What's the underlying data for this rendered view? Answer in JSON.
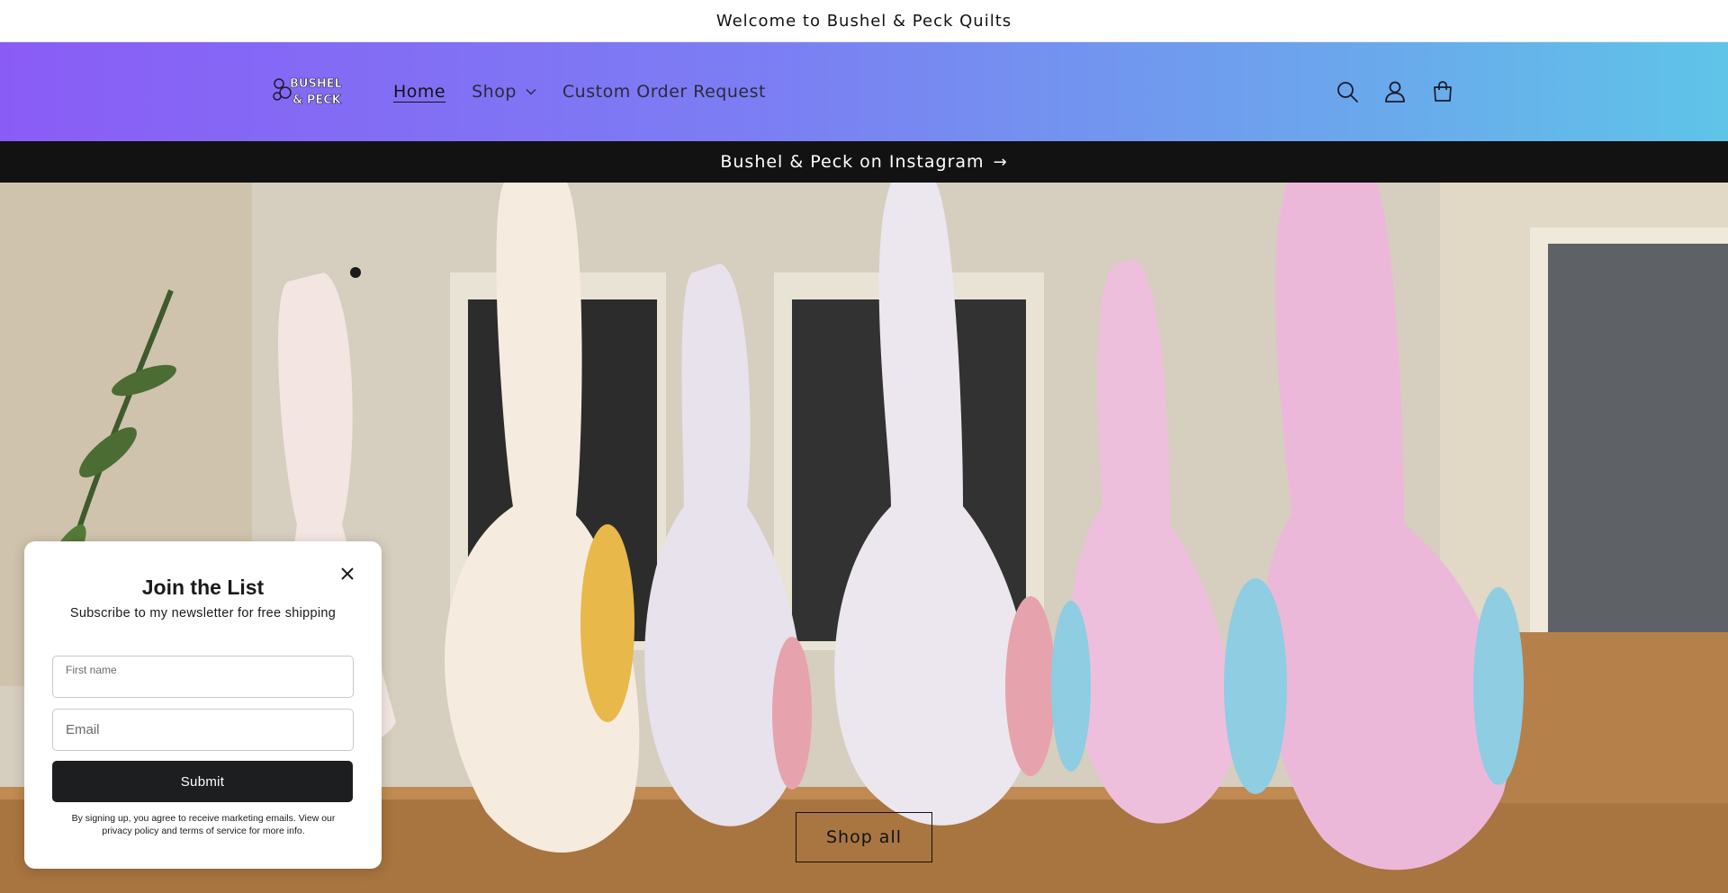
{
  "announcement": {
    "text": "Welcome to Bushel & Peck Quilts"
  },
  "header": {
    "logo_text": [
      "BUSHEL",
      "& PECK"
    ],
    "nav": [
      {
        "label": "Home",
        "active": true
      },
      {
        "label": "Shop",
        "has_dropdown": true
      },
      {
        "label": "Custom Order Request"
      }
    ],
    "icons": [
      "search-icon",
      "account-icon",
      "cart-icon"
    ]
  },
  "insta_bar": {
    "text": "Bushel & Peck on Instagram",
    "arrow": "→"
  },
  "hero": {
    "image": "stuffed fabric goose quilts on porch railing",
    "button_label": "Shop all"
  },
  "popup": {
    "title": "Join the List",
    "subtitle": "Subscribe to my newsletter for free shipping",
    "first_name_label": "First name",
    "email_placeholder": "Email",
    "submit_label": "Submit",
    "disclaimer": "By signing up, you agree to receive marketing emails. View our privacy policy and terms of service for more info."
  },
  "colors": {
    "header_gradient_start": "#8a5cf6",
    "header_gradient_end": "#5fc4e8",
    "dark": "#121212",
    "submit_bg": "#1d1e20"
  }
}
